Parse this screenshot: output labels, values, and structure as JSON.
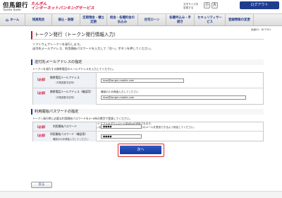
{
  "header": {
    "logo_jp": "但馬銀行",
    "logo_en": "TAJIMA BANK",
    "service_line1": "たんぎん",
    "service_line2": "インターネットバンキングサービス",
    "fontsize_label1": "文字サイズを",
    "fontsize_label2": "変更する",
    "fs_small": "小",
    "fs_large": "大",
    "logout": "ログアウト"
  },
  "nav": {
    "items": [
      {
        "label": "ホーム"
      },
      {
        "label": "残高照会"
      },
      {
        "label": "振込・振替"
      },
      {
        "label": "定期預金・積立定期"
      },
      {
        "label": "税金・各種料金の払込み"
      },
      {
        "label": "住宅ローン"
      },
      {
        "label": "各種申込み・手続き"
      },
      {
        "label": "セキュリティサービス"
      },
      {
        "label": "登録情報の変更"
      }
    ]
  },
  "page": {
    "code": "画面ID：BCT001",
    "title": "トークン発行（トークン発行情報入力）",
    "intro1": "ソフトウェアトークンを発行します。",
    "intro2": "送付先メールアドレス、利用開始パスワードを入力して「次へ」ボタンを押してください。"
  },
  "email_section": {
    "title": "送付先メールアドレスの指定",
    "desc": "トークンを発行する携帯電話のメールアドレスを入力してください。",
    "required": "【必須】",
    "email_label": "携帯電話メールアドレス",
    "email_sub": "（半角英数字記号）",
    "email_value": "taro@tangin.mobile.com",
    "confirm_label": "携帯電話メールアドレス（確認用）",
    "confirm_sub": "（半角英数字記号）",
    "confirm_hint": "確認のため再度入力してください",
    "confirm_value": "taro@tangin.mobile.com"
  },
  "notes": {
    "line1": "※受信したメールアドレスに対して、ワンタイムパスワードアプリのダウンロード用URLが送信されます。",
    "line2": "※ドメイン「@ちば ギンコ」指定受信機能を利用されているお客さまは、「bf@-auth.net」からのメールを受信できるよう設定してください。"
  },
  "password_section": {
    "title": "利用開始パスワードの指定",
    "desc": "トークン発行時に必要な利用開始パスワードを4〜8桁の数字で登録してください。",
    "required": "【必須】",
    "pw_label": "利用開始パスワード",
    "pw_value": "●●●●",
    "pw_confirm_label": "利用開始パスワード（確認用）",
    "pw_confirm_sub": "確認のため再度入力してください",
    "pw_confirm_value": "●●●●"
  },
  "actions": {
    "next": "次へ",
    "back": "戻る"
  }
}
